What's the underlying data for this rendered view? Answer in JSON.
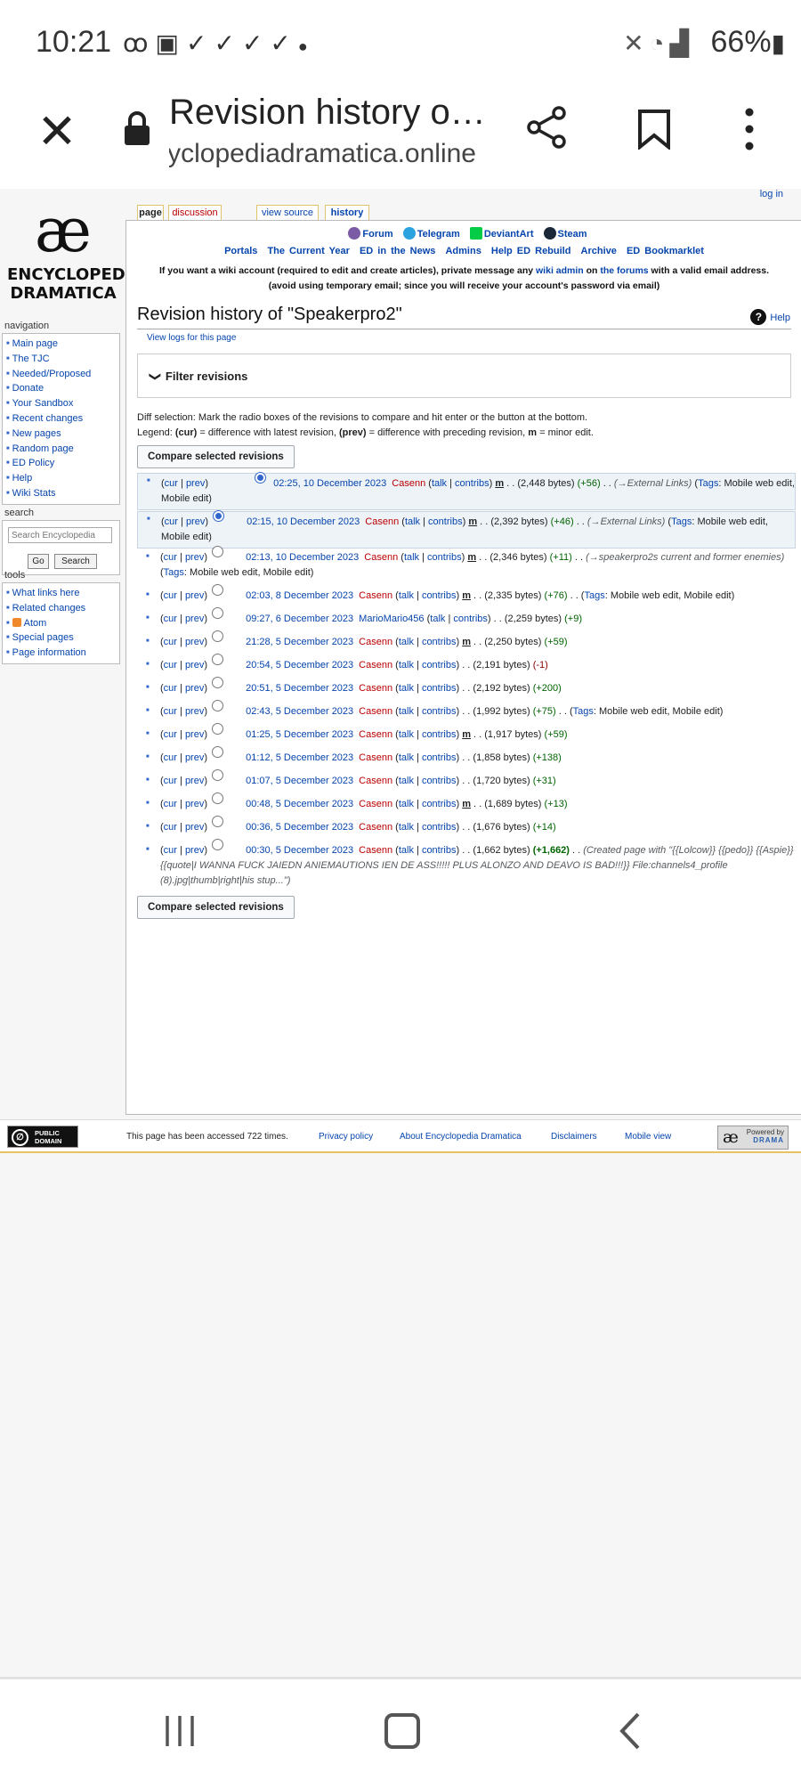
{
  "status_bar": {
    "time": "10:21",
    "left_icons": [
      "voicemail-icon",
      "image-icon",
      "check-icon",
      "check-icon",
      "check-icon",
      "check-icon",
      "dot-icon"
    ],
    "right_icons": [
      "mute-icon",
      "wifi-icon",
      "signal-icon"
    ],
    "battery": "66%"
  },
  "browser": {
    "title": "Revision history o…",
    "url": "encyclopediadramatica.online"
  },
  "sidebar": {
    "logo_lines": [
      "ENCYCLOPEDIA",
      "DRAMATICA"
    ],
    "navigation_heading": "navigation",
    "navigation": [
      "Main page",
      "The TJC",
      "Needed/Proposed",
      "Donate",
      "Your Sandbox",
      "Recent changes",
      "New pages",
      "Random page",
      "ED Policy",
      "Help",
      "Wiki Stats"
    ],
    "search_heading": "search",
    "search_placeholder": "Search Encyclopedia",
    "go_label": "Go",
    "search_label": "Search",
    "tools_heading": "tools",
    "tools": [
      "What links here",
      "Related changes",
      "Atom",
      "Special pages",
      "Page information"
    ]
  },
  "tabs": {
    "page": "page",
    "discussion": "discussion",
    "view_source": "view source",
    "history": "history",
    "login": "log in"
  },
  "top_icons": [
    "Forum",
    "Telegram",
    "DeviantArt",
    "Steam"
  ],
  "top_menu": [
    "Portals",
    "The Current Year",
    "ED in the News",
    "Admins",
    "Help ED Rebuild",
    "Archive",
    "ED Bookmarklet"
  ],
  "notice": {
    "p1": "If you want a wiki account (required to edit and create articles), private message any ",
    "l1": "wiki admin",
    "p2": " on ",
    "l2": "the forums",
    "p3": " with a valid email address.",
    "p4": "(avoid using temporary email; since you will receive your account's password via email)"
  },
  "heading": "Revision history of \"Speakerpro2\"",
  "help": "Help",
  "view_logs": "View logs for this page",
  "filter_label": "Filter revisions",
  "diff_selection": "Diff selection: Mark the radio boxes of the revisions to compare and hit enter or the button at the bottom.",
  "legend": {
    "a": "Legend: ",
    "cur": "(cur)",
    "b": " = difference with latest revision, ",
    "prev": "(prev)",
    "c": " = difference with preceding revision, ",
    "m": "m",
    "d": " = minor edit."
  },
  "compare_button": "Compare selected revisions",
  "revisions": [
    {
      "date": "02:25, 10 December 2023",
      "user": "Casenn",
      "minor": true,
      "bytes": "(2,448 bytes)",
      "diff": "(+56)",
      "comment": "(→External Links)",
      "tags": "Mobile web edit, Mobile edit"
    },
    {
      "date": "02:15, 10 December 2023",
      "user": "Casenn",
      "minor": true,
      "bytes": "(2,392 bytes)",
      "diff": "(+46)",
      "comment": "(→External Links)",
      "tags": "Mobile web edit, Mobile edit"
    },
    {
      "date": "02:13, 10 December 2023",
      "user": "Casenn",
      "minor": true,
      "bytes": "(2,346 bytes)",
      "diff": "(+11)",
      "comment": "(→speakerpro2s current and former enemies)",
      "tags": "Mobile web edit, Mobile edit"
    },
    {
      "date": "02:03, 8 December 2023",
      "user": "Casenn",
      "minor": true,
      "bytes": "(2,335 bytes)",
      "diff": "(+76)",
      "comment": "",
      "tags": "Mobile web edit, Mobile edit"
    },
    {
      "date": "09:27, 6 December 2023",
      "user": "MarioMario456",
      "minor": false,
      "bytes": "(2,259 bytes)",
      "diff": "(+9)",
      "comment": "",
      "tags": ""
    },
    {
      "date": "21:28, 5 December 2023",
      "user": "Casenn",
      "minor": true,
      "bytes": "(2,250 bytes)",
      "diff": "(+59)",
      "comment": "",
      "tags": ""
    },
    {
      "date": "20:54, 5 December 2023",
      "user": "Casenn",
      "minor": false,
      "bytes": "(2,191 bytes)",
      "diff": "(-1)",
      "comment": "",
      "tags": ""
    },
    {
      "date": "20:51, 5 December 2023",
      "user": "Casenn",
      "minor": false,
      "bytes": "(2,192 bytes)",
      "diff": "(+200)",
      "comment": "",
      "tags": ""
    },
    {
      "date": "02:43, 5 December 2023",
      "user": "Casenn",
      "minor": false,
      "bytes": "(1,992 bytes)",
      "diff": "(+75)",
      "comment": "",
      "tags": "Mobile web edit, Mobile edit"
    },
    {
      "date": "01:25, 5 December 2023",
      "user": "Casenn",
      "minor": true,
      "bytes": "(1,917 bytes)",
      "diff": "(+59)",
      "comment": "",
      "tags": ""
    },
    {
      "date": "01:12, 5 December 2023",
      "user": "Casenn",
      "minor": false,
      "bytes": "(1,858 bytes)",
      "diff": "(+138)",
      "comment": "",
      "tags": ""
    },
    {
      "date": "01:07, 5 December 2023",
      "user": "Casenn",
      "minor": false,
      "bytes": "(1,720 bytes)",
      "diff": "(+31)",
      "comment": "",
      "tags": ""
    },
    {
      "date": "00:48, 5 December 2023",
      "user": "Casenn",
      "minor": true,
      "bytes": "(1,689 bytes)",
      "diff": "(+13)",
      "comment": "",
      "tags": ""
    },
    {
      "date": "00:36, 5 December 2023",
      "user": "Casenn",
      "minor": false,
      "bytes": "(1,676 bytes)",
      "diff": "(+14)",
      "comment": "",
      "tags": ""
    },
    {
      "date": "00:30, 5 December 2023",
      "user": "Casenn",
      "minor": false,
      "bytes": "(1,662 bytes)",
      "diff": "(+1,662)",
      "comment": "(Created page with \"{{Lolcow}} {{pedo}} {{Aspie}} {{quote|I WANNA FUCK JAIEDN ANIEMAUTIONS IEN DE ASS!!!!! PLUS ALONZO AND DEAVO IS BAD!!!}} File:channels4_profile (8).jpg|thumb|right|his stup...\")",
      "tags": ""
    }
  ],
  "rev_labels": {
    "cur": "cur",
    "prev": "prev",
    "talk": "talk",
    "contribs": "contribs",
    "m": "m",
    "tags": "Tags"
  },
  "footer": {
    "pd_label": "PUBLIC DOMAIN",
    "accessed": "This page has been accessed 722 times.",
    "privacy": "Privacy policy",
    "about": "About Encyclopedia Dramatica",
    "disclaimers": "Disclaimers",
    "mobile": "Mobile view",
    "powered": "Powered by",
    "powered_brand": "DRAMA"
  }
}
